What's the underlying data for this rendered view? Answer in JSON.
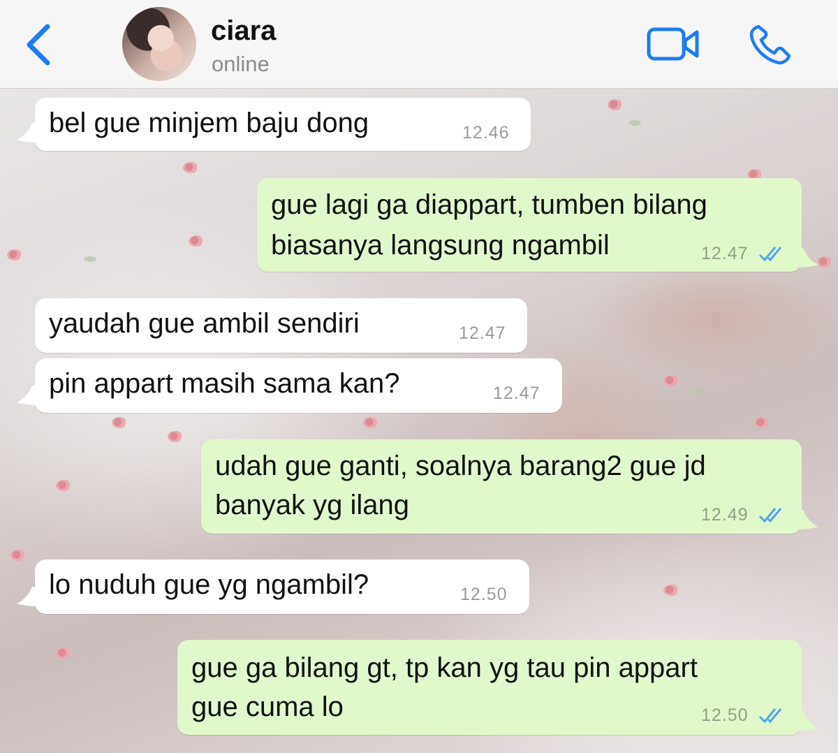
{
  "header": {
    "contact_name": "ciara",
    "contact_status": "online"
  },
  "colors": {
    "accent": "#1d7cf2",
    "incoming_bubble": "#ffffff",
    "outgoing_bubble": "#e1f8cb",
    "read_ticks": "#4fa6e8"
  },
  "icons": {
    "back": "chevron-left-icon",
    "video": "video-camera-icon",
    "call": "phone-icon",
    "read_receipt": "double-check-icon"
  },
  "messages": [
    {
      "direction": "incoming",
      "lines": [
        "bel gue minjem baju dong"
      ],
      "time": "12.46"
    },
    {
      "direction": "outgoing",
      "lines": [
        "gue lagi ga diappart, tumben bilang",
        "biasanya langsung ngambil"
      ],
      "time": "12.47",
      "read": true
    },
    {
      "direction": "incoming",
      "lines": [
        "yaudah gue ambil sendiri"
      ],
      "time": "12.47"
    },
    {
      "direction": "incoming",
      "lines": [
        "pin appart masih sama kan?"
      ],
      "time": "12.47"
    },
    {
      "direction": "outgoing",
      "lines": [
        "udah gue ganti, soalnya barang2 gue jd",
        "banyak yg ilang"
      ],
      "time": "12.49",
      "read": true
    },
    {
      "direction": "incoming",
      "lines": [
        "lo nuduh gue yg ngambil?"
      ],
      "time": "12.50"
    },
    {
      "direction": "outgoing",
      "lines": [
        "gue ga bilang gt, tp kan yg tau pin appart",
        "gue cuma lo"
      ],
      "time": "12.50",
      "read": true
    }
  ]
}
